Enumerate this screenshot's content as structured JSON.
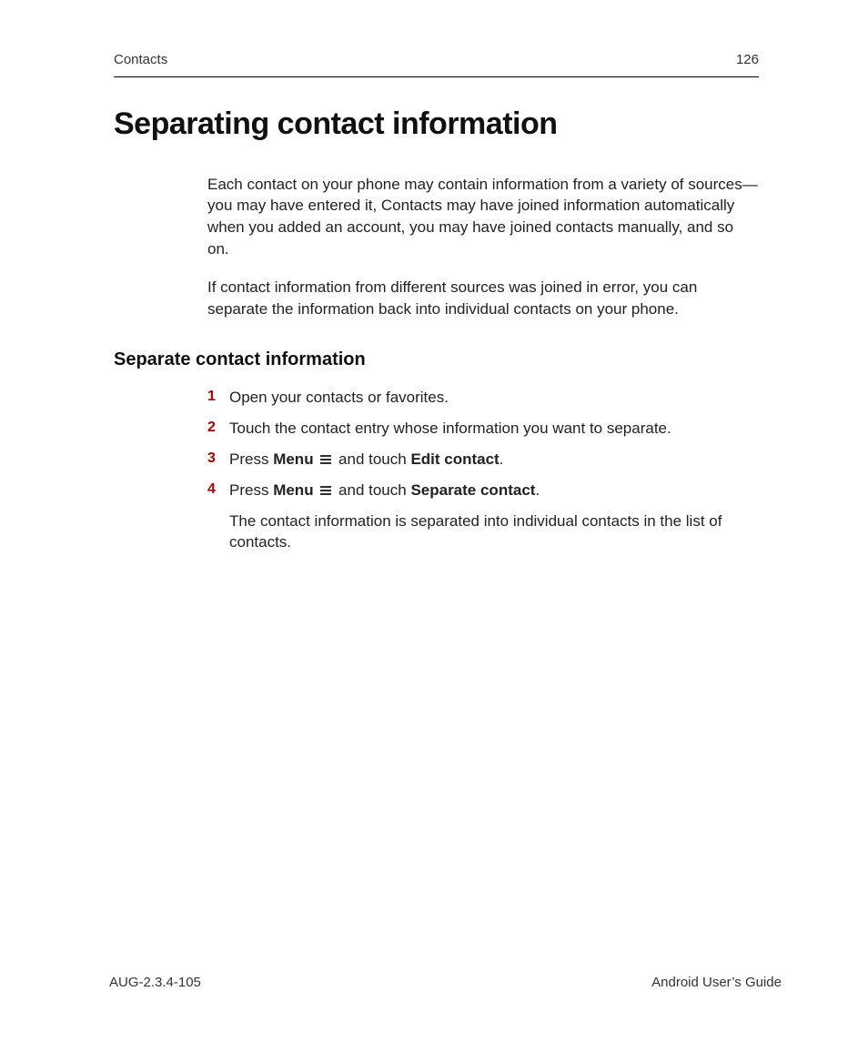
{
  "header": {
    "section": "Contacts",
    "page_number": "126"
  },
  "title": "Separating contact information",
  "intro": {
    "p1": "Each contact on your phone may contain information from a variety of sources—you may have entered it, Contacts may have joined information automatically when you added an account, you may have joined contacts manually, and so on.",
    "p2": "If contact information from different sources was joined in error, you can separate the information back into individual contacts on your phone."
  },
  "subhead": "Separate contact information",
  "steps": {
    "s1": {
      "num": "1",
      "text": "Open your contacts or favorites."
    },
    "s2": {
      "num": "2",
      "text": "Touch the contact entry whose information you want to separate."
    },
    "s3": {
      "num": "3",
      "t1": "Press ",
      "menu": "Menu",
      "t2": " and touch ",
      "action": "Edit contact",
      "t3": "."
    },
    "s4": {
      "num": "4",
      "t1": "Press ",
      "menu": "Menu",
      "t2": " and touch ",
      "action": "Separate contact",
      "t3": "."
    }
  },
  "after_list": "The contact information is separated into individual contacts in the list of contacts.",
  "footer": {
    "doc_id": "AUG-2.3.4-105",
    "guide": "Android User’s Guide"
  },
  "icons": {
    "menu": "menu-icon"
  }
}
